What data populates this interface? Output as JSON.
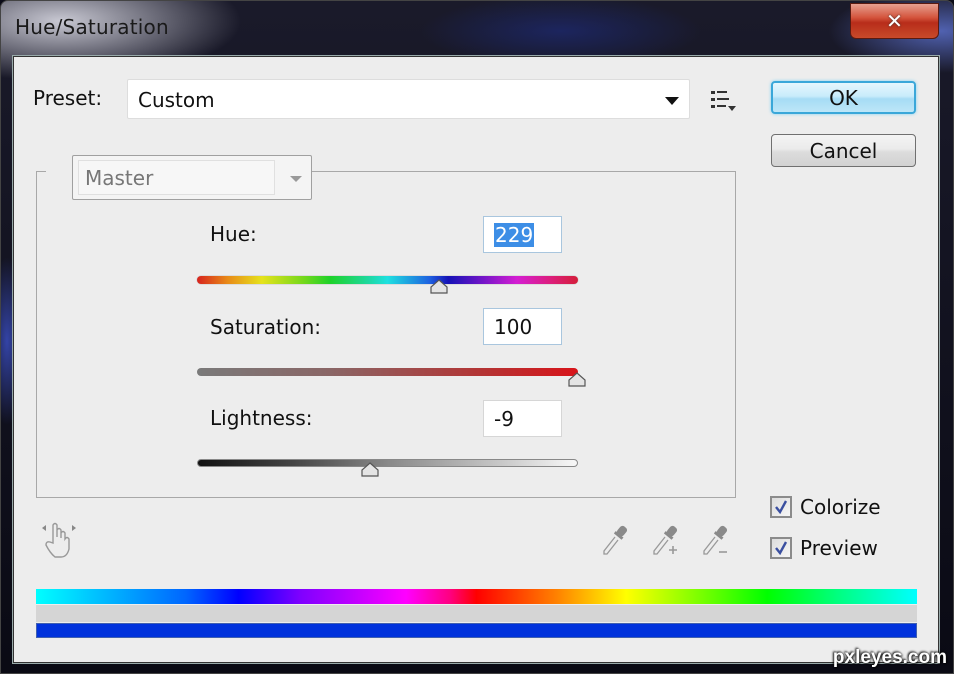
{
  "window": {
    "title": "Hue/Saturation",
    "close_label": "✕"
  },
  "preset": {
    "label": "Preset:",
    "value": "Custom"
  },
  "buttons": {
    "ok": "OK",
    "cancel": "Cancel"
  },
  "channel": {
    "value": "Master"
  },
  "sliders": {
    "hue": {
      "label": "Hue:",
      "value": "229",
      "min": -180,
      "max": 180
    },
    "saturation": {
      "label": "Saturation:",
      "value": "100",
      "min": -100,
      "max": 100
    },
    "lightness": {
      "label": "Lightness:",
      "value": "-9",
      "min": -100,
      "max": 100
    }
  },
  "checkboxes": {
    "colorize": {
      "label": "Colorize",
      "checked": true
    },
    "preview": {
      "label": "Preview",
      "checked": true
    }
  },
  "icons": {
    "preset_menu": "list-menu-icon",
    "targeted_adjustment": "hand-scrubber-icon",
    "eyedropper": "eyedropper-icon",
    "eyedropper_add": "eyedropper-plus-icon",
    "eyedropper_subtract": "eyedropper-minus-icon"
  },
  "colors": {
    "ok_border": "#3aa7d9",
    "result_bar": "#0032dc"
  },
  "watermark": "pxleyes.com"
}
